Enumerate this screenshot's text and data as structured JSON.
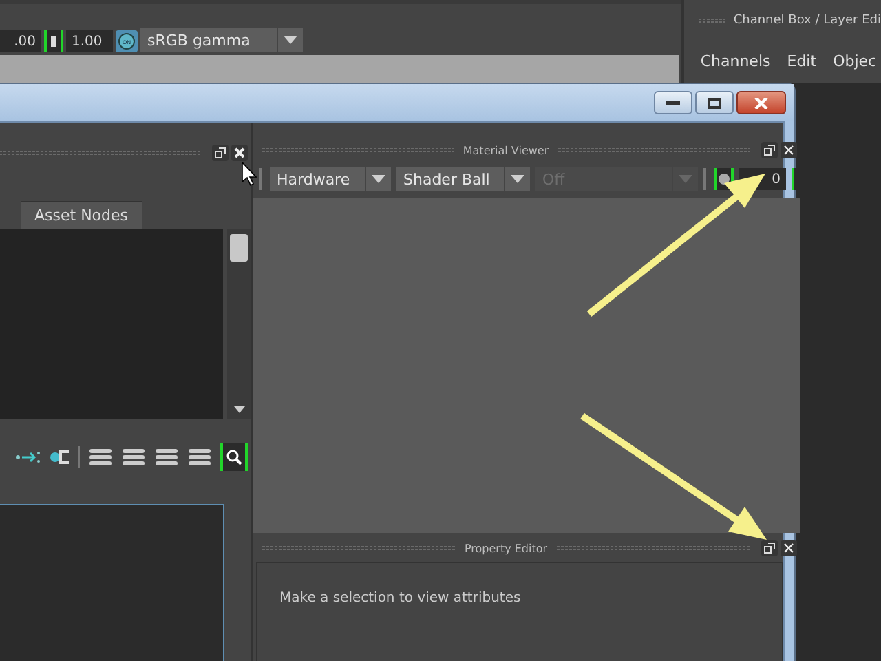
{
  "top_toolbar": {
    "fields": [
      ".00",
      "1.00"
    ],
    "view_transform_toggle": {
      "label": "ON",
      "on": true
    },
    "color_space": {
      "value": "sRGB gamma"
    }
  },
  "channel_box": {
    "title": "Channel Box / Layer Edi",
    "menu": [
      "Channels",
      "Edit",
      "Objec"
    ]
  },
  "left_panel": {
    "tabs": [
      {
        "label": "Asset Nodes",
        "selected": true
      }
    ]
  },
  "material_viewer": {
    "title": "Material Viewer",
    "dropdowns": [
      {
        "value": "Hardware",
        "disabled": false
      },
      {
        "value": "Shader Ball",
        "disabled": false
      },
      {
        "value": "Off",
        "disabled": true
      }
    ],
    "field": "0"
  },
  "property_editor": {
    "title": "Property Editor",
    "message": "Make a selection to view attributes"
  }
}
